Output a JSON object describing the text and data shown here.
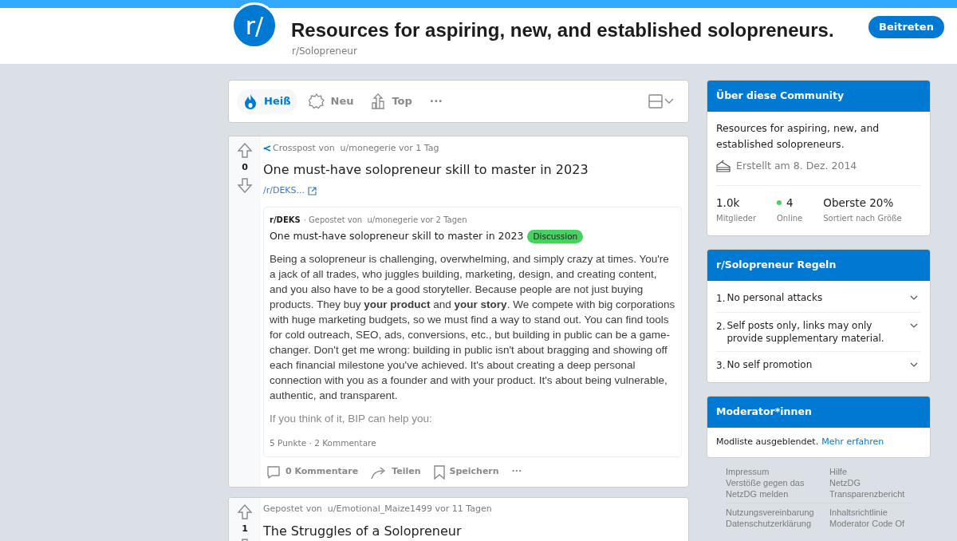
{
  "header": {
    "logo": "r/",
    "title": "Resources for aspiring, new, and established solopreneurs.",
    "subreddit": "r/Solopreneur",
    "join_button": "Beitreten"
  },
  "sort_tabs": [
    {
      "label": "Heiß",
      "kind": "hot",
      "selected": true
    },
    {
      "label": "Neu",
      "kind": "new",
      "selected": false
    },
    {
      "label": "Top",
      "kind": "top",
      "selected": false
    }
  ],
  "sort_more": "···",
  "posts": [
    {
      "kind": "crosspost",
      "score": "0",
      "meta_prefix": "Crosspost von",
      "author": "u/monegerie",
      "age": "vor 1 Tag",
      "title": "One must-have solopreneur skill to master in 2023",
      "link": "/r/DEKS...",
      "embed": {
        "subreddit": "r/DEKS",
        "meta": "· Gepostet von  u/monegerie vor 2 Tagen",
        "title": "One must-have solopreneur skill to master in 2023",
        "flair": "Discussion",
        "body": [
          "Being a solopreneur is challenging, overwhelming, and simply crazy at times. You're a jack of all trades, who juggles building, marketing, design, and creating content, and you also have to be a good storyteller. Because people are not just buying products. They buy **your product** and **your story**. We compete with big corporations with huge marketing budgets, so we must find a way to stand out. You can find tools for cold outreach, SEO, ads, conversions, etc., but building in public can be a game-changer. Don't get me wrong: building in public isn't about bragging and showing off each financial milestone you've achieved. It's about creating a deep personal connection with you as a founder and with your product. It's about being vulnerable, authentic, and transparent.",
          "If you think of it, BIP can help you:"
        ],
        "stats": "5 Punkte · 2 Kommentare"
      },
      "actions": [
        {
          "kind": "comments",
          "label": "0 Kommentare"
        },
        {
          "kind": "share",
          "label": "Teilen"
        },
        {
          "kind": "save",
          "label": "Speichern"
        },
        {
          "kind": "more",
          "label": "···"
        }
      ]
    },
    {
      "kind": "text",
      "score": "1",
      "meta_prefix": "Gepostet von",
      "author": "u/Emotional_Maize1499",
      "age": "vor 11 Tagen",
      "title": "The Struggles of a Solopreneur"
    }
  ],
  "about": {
    "heading": "Über diese Community",
    "description": "Resources for aspiring, new, and established solopreneurs.",
    "created": "Erstellt am 8. Dez. 2014",
    "stats": [
      {
        "kind": "members",
        "value": "1.0k",
        "label": "Mitglieder"
      },
      {
        "kind": "online",
        "value": "4",
        "label": "Online"
      },
      {
        "kind": "rank",
        "value": "Oberste 20%",
        "label": "Sortiert nach Größe"
      }
    ]
  },
  "rules": {
    "heading": "r/Solopreneur Regeln",
    "items": [
      {
        "number": "1.",
        "text": "No personal attacks"
      },
      {
        "number": "2.",
        "text": "Self posts only, links may only provide supplementary material."
      },
      {
        "number": "3.",
        "text": "No self promotion"
      }
    ]
  },
  "moderators": {
    "heading": "Moderator*innen",
    "text": "Modliste ausgeblendet.",
    "link": "Mehr erfahren"
  },
  "footer": [
    [
      [
        "Impressum",
        "Verstöße gegen das NetzDG melden"
      ],
      [
        "Hilfe",
        "NetzDG",
        "Transparenzbericht"
      ]
    ],
    [
      [
        "Nutzungsvereinbarung",
        "Datenschutzerklärung"
      ],
      [
        "Inhaltsrichtlinie",
        "Moderator Code Of"
      ]
    ]
  ]
}
